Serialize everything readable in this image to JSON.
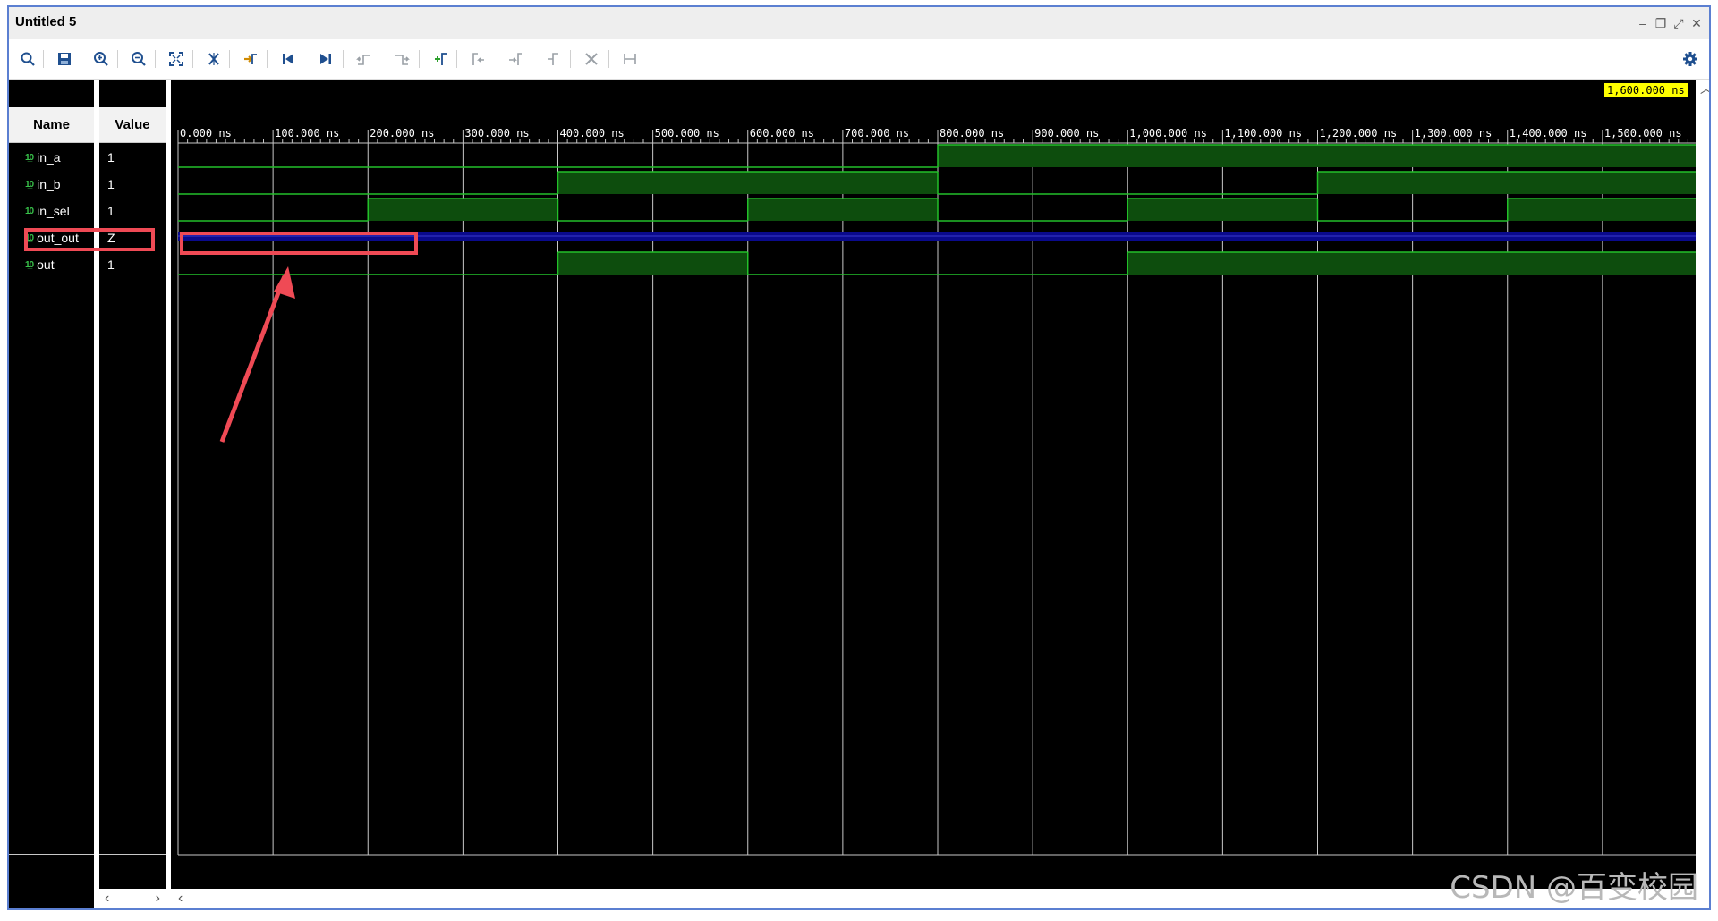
{
  "window": {
    "title": "Untitled 5"
  },
  "window_controls": [
    "minimize-icon",
    "restore-icon",
    "float-icon",
    "close-icon"
  ],
  "toolbar": {
    "icons": [
      "search-icon",
      "save-icon",
      "zoom-in-icon",
      "zoom-out-icon",
      "zoom-fit-icon",
      "swap-cursor-icon",
      "snap-transition-icon",
      "go-to-start-icon",
      "go-to-end-icon",
      "previous-transition-icon",
      "next-transition-icon",
      "add-marker-icon",
      "previous-marker-icon",
      "next-marker-icon",
      "marker-icon",
      "delete-marker-icon",
      "marker-span-icon"
    ],
    "settings_icon": "gear-icon"
  },
  "columns": {
    "name_header": "Name",
    "value_header": "Value"
  },
  "signals": [
    {
      "name": "in_a",
      "value": "1"
    },
    {
      "name": "in_b",
      "value": "1"
    },
    {
      "name": "in_sel",
      "value": "1"
    },
    {
      "name": "out_out",
      "value": "Z"
    },
    {
      "name": "out",
      "value": "1"
    }
  ],
  "timeline": {
    "unit": "ns",
    "end": 1600,
    "cursor_label": "1,600.000 ns",
    "tick_labels": [
      "0.000 ns",
      "100.000 ns",
      "200.000 ns",
      "300.000 ns",
      "400.000 ns",
      "500.000 ns",
      "600.000 ns",
      "700.000 ns",
      "800.000 ns",
      "900.000 ns",
      "1,000.000 ns",
      "1,100.000 ns",
      "1,200.000 ns",
      "1,300.000 ns",
      "1,400.000 ns",
      "1,500.000 ns"
    ]
  },
  "waveforms": {
    "in_a": {
      "type": "bit",
      "segments": [
        [
          0,
          800,
          0
        ],
        [
          800,
          1600,
          1
        ]
      ]
    },
    "in_b": {
      "type": "bit",
      "segments": [
        [
          0,
          400,
          0
        ],
        [
          400,
          800,
          1
        ],
        [
          800,
          1200,
          0
        ],
        [
          1200,
          1600,
          1
        ]
      ]
    },
    "in_sel": {
      "type": "bit",
      "segments": [
        [
          0,
          200,
          0
        ],
        [
          200,
          400,
          1
        ],
        [
          400,
          600,
          0
        ],
        [
          600,
          800,
          1
        ],
        [
          800,
          1000,
          0
        ],
        [
          1000,
          1200,
          1
        ],
        [
          1200,
          1400,
          0
        ],
        [
          1400,
          1600,
          1
        ]
      ]
    },
    "out_out": {
      "type": "highz",
      "segments": [
        [
          0,
          1600,
          "Z"
        ]
      ]
    },
    "out": {
      "type": "bit",
      "segments": [
        [
          0,
          400,
          0
        ],
        [
          400,
          600,
          1
        ],
        [
          600,
          1000,
          0
        ],
        [
          1000,
          1600,
          1
        ]
      ]
    }
  },
  "colors": {
    "wave_green": "#23c02a",
    "wave_fill": "#0d4d0d",
    "highz_blue": "#0a0a8c",
    "grid": "#c8c8c8",
    "highlight": "#ef4a55",
    "cursor_label_bg": "#ffff00"
  },
  "scrollbar": {
    "left_icon": "chevron-left-icon",
    "right_icon": "chevron-right-icon",
    "up_icon": "chevron-up-icon"
  },
  "watermark": "CSDN @百变校园"
}
